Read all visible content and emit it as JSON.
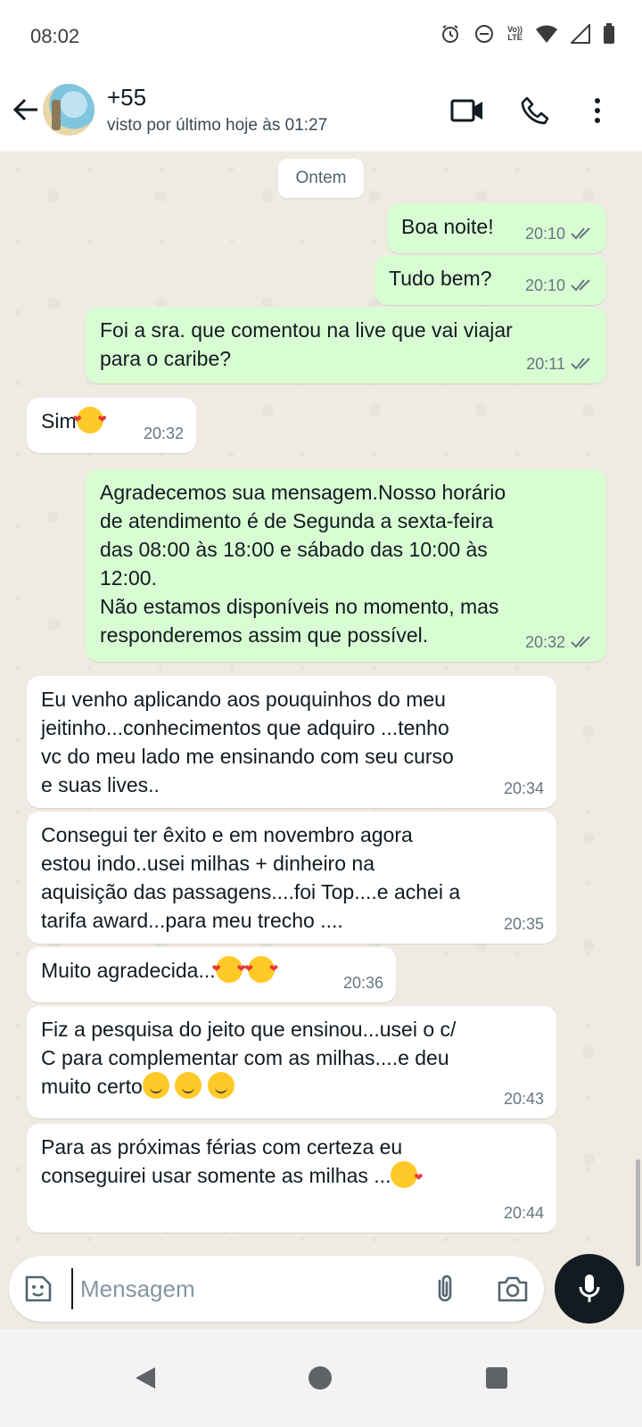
{
  "status_bar": {
    "time": "08:02",
    "lte_top": "Vo))",
    "lte_bottom": "LTE"
  },
  "header": {
    "contact_name": "+55",
    "contact_status": "visto por último hoje às 01:27"
  },
  "chat": {
    "date_chip": "Ontem",
    "messages": [
      {
        "direction": "out",
        "text": "Boa noite!",
        "time": "20:10",
        "read": true
      },
      {
        "direction": "out",
        "text": "Tudo bem?",
        "time": "20:10",
        "read": true
      },
      {
        "direction": "out",
        "text": "Foi a sra. que comentou na live que vai viajar\npara o caribe?",
        "time": "20:11",
        "read": true
      },
      {
        "direction": "in",
        "text": "Sim",
        "emoji": "smiling-face-with-hearts",
        "time": "20:32"
      },
      {
        "direction": "out",
        "text": "Agradecemos sua mensagem.Nosso horário\nde atendimento é de Segunda a sexta-feira\ndas 08:00 às 18:00 e sábado das 10:00 às\n12:00.\nNão estamos disponíveis no momento, mas\nresponderemos assim que possível.",
        "time": "20:32",
        "read": true
      },
      {
        "direction": "in",
        "text": "Eu venho aplicando aos pouquinhos do meu\njeitinho...conhecimentos que adquiro ...tenho\nvc do meu lado me ensinando com seu curso\ne suas lives..",
        "time": "20:34"
      },
      {
        "direction": "in",
        "text": "Consegui ter êxito e em novembro agora\nestou indo..usei milhas + dinheiro  na\naquisição das passagens....foi Top....e achei a\ntarifa award...para meu trecho ....",
        "time": "20:35"
      },
      {
        "direction": "in",
        "text": "Muito agradecida...",
        "emoji": "smiling-face-with-hearts x2",
        "time": "20:36"
      },
      {
        "direction": "in",
        "text": "Fiz a pesquisa do jeito que ensinou...usei o c/\nC  para complementar com as milhas....e deu\nmuito certo",
        "emoji": "smiling-face x3",
        "time": "20:43"
      },
      {
        "direction": "in",
        "text": "Para as próximas férias com certeza eu\nconseguirei usar somente as milhas ...",
        "emoji": "face-blowing-kiss",
        "time": "20:44"
      }
    ]
  },
  "input": {
    "placeholder": "Mensagem"
  },
  "colors": {
    "outgoing_bubble": "#d9fdd3",
    "incoming_bubble": "#ffffff",
    "chat_background": "#efeae2",
    "read_ticks": "#667781"
  },
  "icons": [
    "back-arrow-icon",
    "video-call-icon",
    "phone-icon",
    "more-options-icon",
    "sticker-icon",
    "attach-icon",
    "camera-icon",
    "mic-icon"
  ]
}
